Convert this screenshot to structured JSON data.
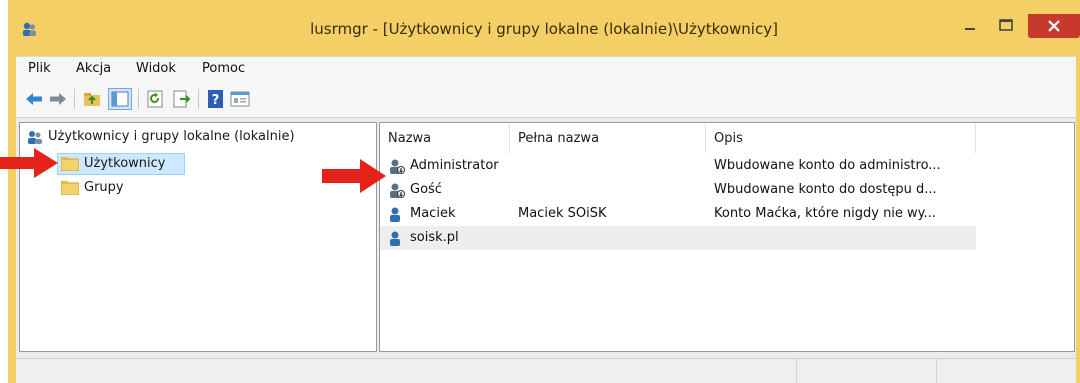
{
  "window": {
    "title": "lusrmgr - [Użytkownicy i grupy lokalne (lokalnie)\\Użytkownicy]"
  },
  "menu": [
    {
      "label": "Plik"
    },
    {
      "label": "Akcja"
    },
    {
      "label": "Widok"
    },
    {
      "label": "Pomoc"
    }
  ],
  "toolbar": {
    "icons": [
      "back-icon",
      "forward-icon",
      "up-folder-icon",
      "show-tree-icon",
      "refresh-icon",
      "export-icon",
      "help-icon",
      "properties-icon"
    ]
  },
  "tree": {
    "root": "Użytkownicy i grupy lokalne (lokalnie)",
    "children": [
      {
        "label": "Użytkownicy",
        "selected": true
      },
      {
        "label": "Grupy",
        "selected": false
      }
    ]
  },
  "list": {
    "columns": [
      "Nazwa",
      "Pełna nazwa",
      "Opis"
    ],
    "rows": [
      {
        "name": "Administrator",
        "full": "",
        "desc": "Wbudowane konto do administro..."
      },
      {
        "name": "Gość",
        "full": "",
        "desc": "Wbudowane konto do dostępu d..."
      },
      {
        "name": "Maciek",
        "full": "Maciek SOiSK",
        "desc": "Konto Maćka, które nigdy nie wy..."
      },
      {
        "name": "soisk.pl",
        "full": "",
        "desc": ""
      }
    ]
  },
  "colors": {
    "titlebar": "#f4cf66",
    "close": "#c8392d",
    "annotation_arrow": "#e5231b",
    "selection": "#cde8ff"
  }
}
